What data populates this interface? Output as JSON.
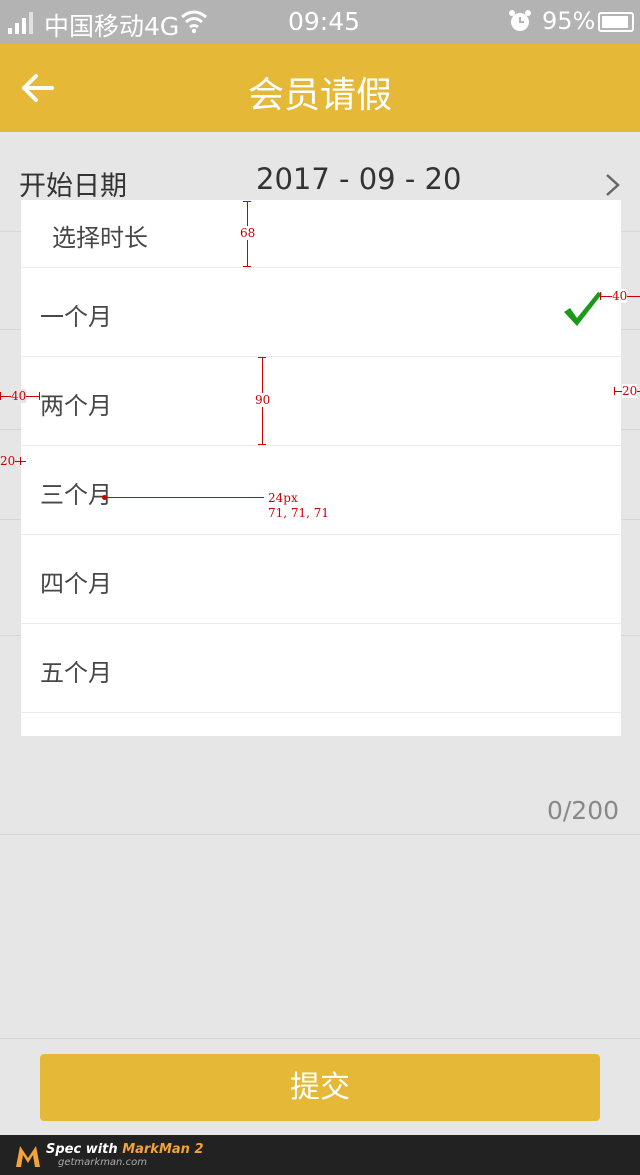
{
  "status_bar": {
    "carrier": "中国移动4G",
    "time": "09:45",
    "battery": "95%"
  },
  "nav": {
    "title": "会员请假"
  },
  "start_date": {
    "label": "开始日期",
    "value": "2017 - 09 - 20"
  },
  "sheet": {
    "title": "选择时长",
    "options": [
      {
        "label": "一个月",
        "selected": true
      },
      {
        "label": "两个月",
        "selected": false
      },
      {
        "label": "三个月",
        "selected": false
      },
      {
        "label": "四个月",
        "selected": false
      },
      {
        "label": "五个月",
        "selected": false
      }
    ]
  },
  "remarks": {
    "counter": "0/200"
  },
  "submit": {
    "label": "提交"
  },
  "annotations": {
    "header_height": "68",
    "row_height": "90",
    "right_margin": "40",
    "left_margin": "40",
    "right_small": "20",
    "left_small": "20",
    "font_size": "24px",
    "font_color": "71, 71, 71"
  },
  "footer": {
    "brand_prefix": "Spec with ",
    "brand_name": "MarkMan 2",
    "url": "getmarkman.com"
  },
  "colors": {
    "accent": "#e5b937",
    "check": "#1a9a1a",
    "status_bar": "#b3b3b3",
    "background": "#e6e6e6"
  }
}
